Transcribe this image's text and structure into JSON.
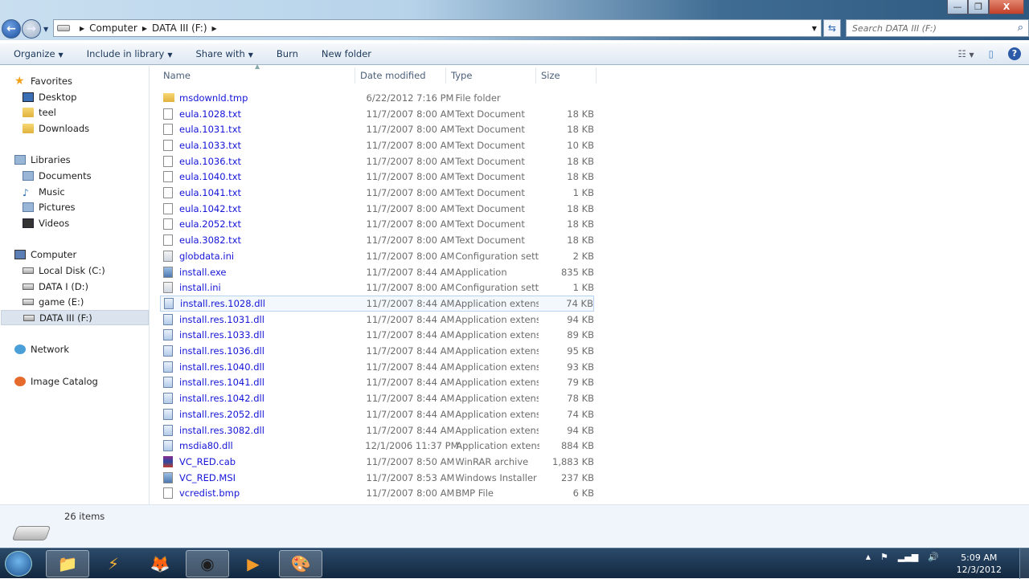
{
  "window": {
    "minimize": "—",
    "maximize": "❐",
    "close": "X"
  },
  "address": {
    "crumbs": [
      "Computer",
      "DATA III (F:)"
    ],
    "search_placeholder": "Search DATA III (F:)"
  },
  "toolbar": {
    "organize": "Organize",
    "include": "Include in library",
    "share": "Share with",
    "burn": "Burn",
    "new_folder": "New folder"
  },
  "sidebar": {
    "favorites": {
      "label": "Favorites",
      "items": [
        "Desktop",
        "teel",
        "Downloads"
      ]
    },
    "libraries": {
      "label": "Libraries",
      "items": [
        "Documents",
        "Music",
        "Pictures",
        "Videos"
      ]
    },
    "computer": {
      "label": "Computer",
      "items": [
        "Local Disk (C:)",
        "DATA I (D:)",
        "game (E:)",
        "DATA III (F:)"
      ]
    },
    "network": "Network",
    "image_catalog": "Image Catalog"
  },
  "columns": {
    "name": "Name",
    "date": "Date modified",
    "type": "Type",
    "size": "Size"
  },
  "files": [
    {
      "name": "msdownld.tmp",
      "date": "6/22/2012 7:16 PM",
      "type": "File folder",
      "size": "",
      "icon": "folder"
    },
    {
      "name": "eula.1028.txt",
      "date": "11/7/2007 8:00 AM",
      "type": "Text Document",
      "size": "18 KB",
      "icon": "txt"
    },
    {
      "name": "eula.1031.txt",
      "date": "11/7/2007 8:00 AM",
      "type": "Text Document",
      "size": "18 KB",
      "icon": "txt"
    },
    {
      "name": "eula.1033.txt",
      "date": "11/7/2007 8:00 AM",
      "type": "Text Document",
      "size": "10 KB",
      "icon": "txt"
    },
    {
      "name": "eula.1036.txt",
      "date": "11/7/2007 8:00 AM",
      "type": "Text Document",
      "size": "18 KB",
      "icon": "txt"
    },
    {
      "name": "eula.1040.txt",
      "date": "11/7/2007 8:00 AM",
      "type": "Text Document",
      "size": "18 KB",
      "icon": "txt"
    },
    {
      "name": "eula.1041.txt",
      "date": "11/7/2007 8:00 AM",
      "type": "Text Document",
      "size": "1 KB",
      "icon": "txt"
    },
    {
      "name": "eula.1042.txt",
      "date": "11/7/2007 8:00 AM",
      "type": "Text Document",
      "size": "18 KB",
      "icon": "txt"
    },
    {
      "name": "eula.2052.txt",
      "date": "11/7/2007 8:00 AM",
      "type": "Text Document",
      "size": "18 KB",
      "icon": "txt"
    },
    {
      "name": "eula.3082.txt",
      "date": "11/7/2007 8:00 AM",
      "type": "Text Document",
      "size": "18 KB",
      "icon": "txt"
    },
    {
      "name": "globdata.ini",
      "date": "11/7/2007 8:00 AM",
      "type": "Configuration sett...",
      "size": "2 KB",
      "icon": "ini"
    },
    {
      "name": "install.exe",
      "date": "11/7/2007 8:44 AM",
      "type": "Application",
      "size": "835 KB",
      "icon": "exe"
    },
    {
      "name": "install.ini",
      "date": "11/7/2007 8:00 AM",
      "type": "Configuration sett...",
      "size": "1 KB",
      "icon": "ini"
    },
    {
      "name": "install.res.1028.dll",
      "date": "11/7/2007 8:44 AM",
      "type": "Application extens...",
      "size": "74 KB",
      "icon": "dll"
    },
    {
      "name": "install.res.1031.dll",
      "date": "11/7/2007 8:44 AM",
      "type": "Application extens...",
      "size": "94 KB",
      "icon": "dll"
    },
    {
      "name": "install.res.1033.dll",
      "date": "11/7/2007 8:44 AM",
      "type": "Application extens...",
      "size": "89 KB",
      "icon": "dll"
    },
    {
      "name": "install.res.1036.dll",
      "date": "11/7/2007 8:44 AM",
      "type": "Application extens...",
      "size": "95 KB",
      "icon": "dll"
    },
    {
      "name": "install.res.1040.dll",
      "date": "11/7/2007 8:44 AM",
      "type": "Application extens...",
      "size": "93 KB",
      "icon": "dll"
    },
    {
      "name": "install.res.1041.dll",
      "date": "11/7/2007 8:44 AM",
      "type": "Application extens...",
      "size": "79 KB",
      "icon": "dll"
    },
    {
      "name": "install.res.1042.dll",
      "date": "11/7/2007 8:44 AM",
      "type": "Application extens...",
      "size": "78 KB",
      "icon": "dll"
    },
    {
      "name": "install.res.2052.dll",
      "date": "11/7/2007 8:44 AM",
      "type": "Application extens...",
      "size": "74 KB",
      "icon": "dll"
    },
    {
      "name": "install.res.3082.dll",
      "date": "11/7/2007 8:44 AM",
      "type": "Application extens...",
      "size": "94 KB",
      "icon": "dll"
    },
    {
      "name": "msdia80.dll",
      "date": "12/1/2006 11:37 PM",
      "type": "Application extens...",
      "size": "884 KB",
      "icon": "dll"
    },
    {
      "name": "VC_RED.cab",
      "date": "11/7/2007 8:50 AM",
      "type": "WinRAR archive",
      "size": "1,883 KB",
      "icon": "cab"
    },
    {
      "name": "VC_RED.MSI",
      "date": "11/7/2007 8:53 AM",
      "type": "Windows Installer ...",
      "size": "237 KB",
      "icon": "exe"
    },
    {
      "name": "vcredist.bmp",
      "date": "11/7/2007 8:00 AM",
      "type": "BMP File",
      "size": "6 KB",
      "icon": "txt"
    }
  ],
  "status": {
    "count": "26 items"
  },
  "taskbar": {
    "time": "5:09 AM",
    "date": "12/3/2012"
  }
}
